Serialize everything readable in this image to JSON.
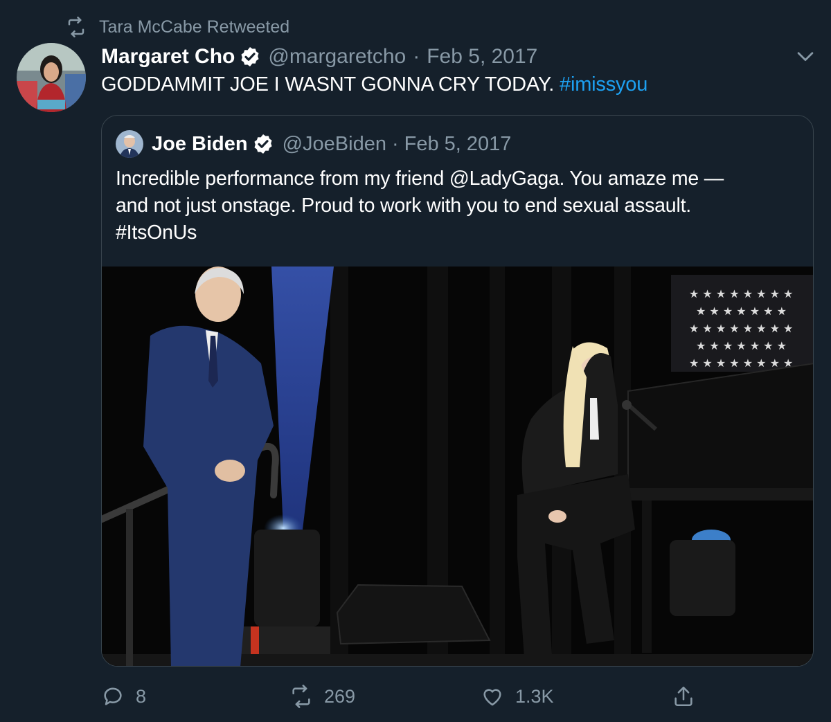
{
  "retweet_notice": {
    "icon": "retweet-icon",
    "text": "Tara McCabe Retweeted"
  },
  "tweet": {
    "author_name": "Margaret Cho",
    "handle": "@margaretcho",
    "separator": "·",
    "date": "Feb 5, 2017",
    "text_main": "GODDAMMIT JOE I WASNT GONNA CRY TODAY.",
    "hashtag": "#imissyou"
  },
  "quoted": {
    "author_name": "Joe Biden",
    "handle": "@JoeBiden",
    "separator": "·",
    "date": "Feb 5, 2017",
    "lines": [
      "Incredible performance from my friend @LadyGaga. You amaze me —",
      "and not just onstage. Proud to work with you to end sexual assault.",
      "#ItsOnUs"
    ]
  },
  "actions": {
    "reply_count": "8",
    "retweet_count": "269",
    "like_count": "1.3K"
  },
  "colors": {
    "background": "#15202b",
    "secondary_text": "#8899a6",
    "accent": "#1da1f2",
    "border": "#38444d"
  }
}
